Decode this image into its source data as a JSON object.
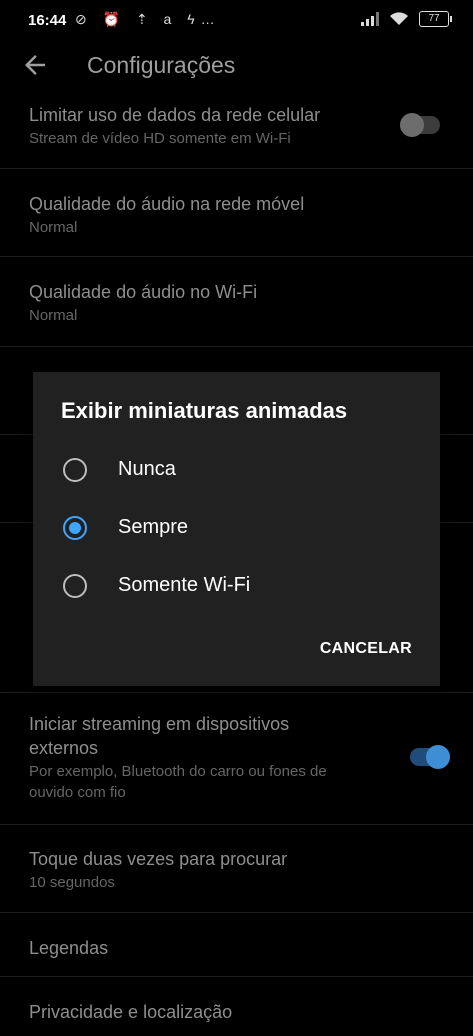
{
  "status_bar": {
    "time": "16:44",
    "left_icons": "⊘ ⏰ ⇡ a ϟ…",
    "battery": "77"
  },
  "app_bar": {
    "title": "Configurações"
  },
  "settings": [
    {
      "title": "Limitar uso de dados da rede celular",
      "subtitle": "Stream de vídeo HD somente em Wi-Fi",
      "toggle": "off"
    },
    {
      "title": "Qualidade do áudio na rede móvel",
      "subtitle": "Normal"
    },
    {
      "title": "Qualidade do áudio no Wi-Fi",
      "subtitle": "Normal"
    },
    {
      "title": "Iniciar streaming em dispositivos externos",
      "subtitle": "Por exemplo, Bluetooth do carro ou fones de ouvido com fio",
      "toggle": "on"
    },
    {
      "title": "Toque duas vezes para procurar",
      "subtitle": "10 segundos"
    },
    {
      "title": "Legendas"
    },
    {
      "title": "Privacidade e localização"
    }
  ],
  "dialog": {
    "title": "Exibir miniaturas animadas",
    "options": [
      {
        "label": "Nunca",
        "selected": false
      },
      {
        "label": "Sempre",
        "selected": true
      },
      {
        "label": "Somente Wi-Fi",
        "selected": false
      }
    ],
    "cancel_label": "CANCELAR"
  },
  "colors": {
    "accent": "#3ea6ff",
    "dialog_bg": "#212121",
    "background": "#000000"
  }
}
